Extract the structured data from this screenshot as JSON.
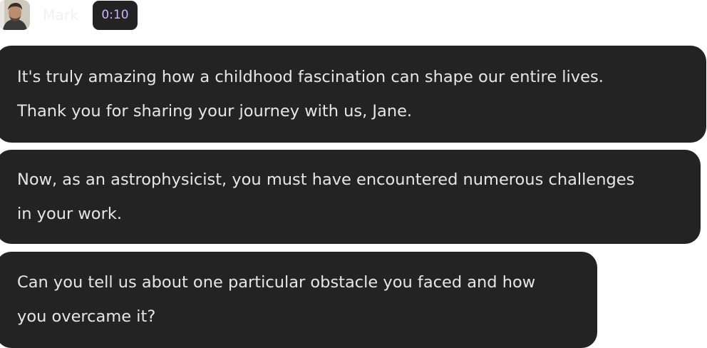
{
  "header": {
    "speaker_name": "Mark",
    "timestamp": "0:10",
    "avatar_icon": "person-avatar"
  },
  "messages": [
    {
      "lines": [
        "It's truly amazing how a childhood fascination can shape our entire lives.",
        "Thank you for sharing your journey with us, Jane."
      ]
    },
    {
      "lines": [
        "Now, as an astrophysicist, you must have encountered numerous challenges",
        "in your work."
      ]
    },
    {
      "lines": [
        "Can you tell us about one particular obstacle you faced and how",
        "you overcame it?"
      ]
    }
  ],
  "colors": {
    "bubble_bg": "#232323",
    "text": "#e6e6e6",
    "timestamp_text": "#c9b7ff"
  }
}
